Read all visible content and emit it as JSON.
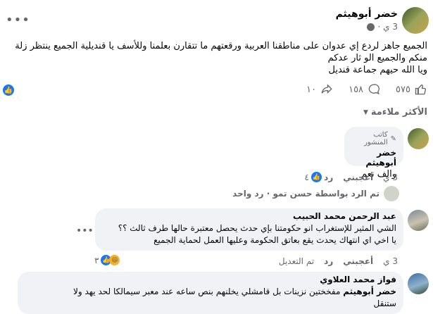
{
  "post": {
    "author": "خضر أبوهيثم",
    "time": "3 ي",
    "text_lines": [
      "الجميع جاهز لردع إي عدوان على مناطقنا العربية ورقعتهم ما تتقارن بعلمنا وللأسف يا قنديلية الجميع ينتظر زلة",
      "منكم والجميع الو ثار عدكم",
      "ويا الله حيهم جماعة قنديل"
    ],
    "likes_count": "٥٧٥",
    "comments_count": "١٥٨",
    "shares_count": "١٠",
    "sort_label": "الأكثر ملاءمة"
  },
  "comments": [
    {
      "author_badge": "كاتب المنشور",
      "author": "خضر أبوهيثم",
      "text": "والف نعم",
      "time": "3 ي",
      "like": "أعجبني",
      "reply": "رد",
      "reactions": "٤"
    },
    {
      "reply_summary": "تم الرد بواسطة حسن تمو · رد واحد"
    },
    {
      "author": "عبد الرحمن محمد الحبيب",
      "text_lines": [
        "الشي المثير للإستغراب انو حكومتنا بإي حدث يحصل معتبرة حالها طرف ثالث ؟؟",
        "يا اخي اي انتهاك يحدث يقع بعاتق الحكومة وعليها العمل لحماية الجميع"
      ],
      "time": "3 ي",
      "like": "أعجبني",
      "reply": "رد",
      "edited": "تم التعديل",
      "reactions": "٣"
    },
    {
      "author": "فواز محمد العلاوي",
      "mention": "خضر أبوهيثم",
      "text": "مفخختين نزينات بل قامشلي يخلنهم بنص ساعه عند معبر سيمالكا لحد يهد ولا",
      "text_cont": "ستنقل"
    }
  ],
  "colors": {
    "like_blue": "#1877f2",
    "love_red": "#f33e58",
    "haha_yellow": "#f7b125"
  }
}
